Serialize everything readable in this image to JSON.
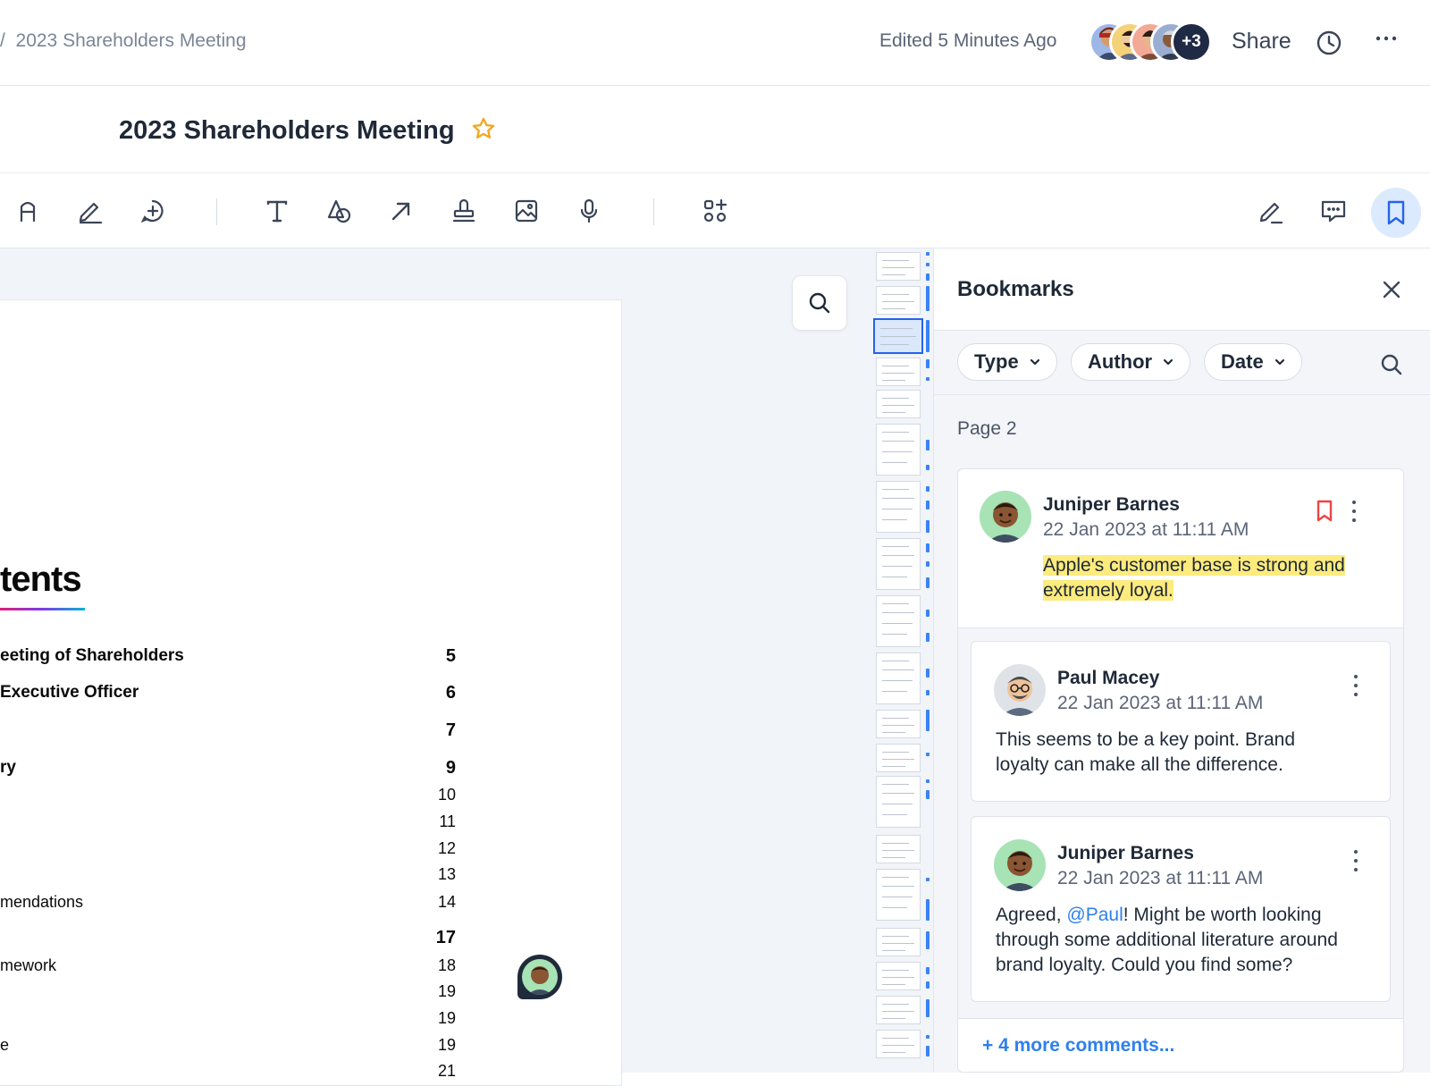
{
  "header": {
    "breadcrumb_sep": "/",
    "breadcrumb": "2023 Shareholders Meeting",
    "edited": "Edited 5 Minutes Ago",
    "avatars_more": "+3",
    "share_label": "Share"
  },
  "document": {
    "title": "2023 Shareholders Meeting",
    "heading": "tents",
    "toc": [
      {
        "label": "eeting of Shareholders",
        "page": "5"
      },
      {
        "label": "Executive Officer",
        "page": "6"
      },
      {
        "label": "",
        "page": "7"
      },
      {
        "label": "ry",
        "page": "9"
      },
      {
        "label": "",
        "page": "10"
      },
      {
        "label": "",
        "page": "11"
      },
      {
        "label": "",
        "page": "12"
      },
      {
        "label": "",
        "page": "13"
      },
      {
        "label": "mendations",
        "page": "14"
      },
      {
        "label": "",
        "page": "17"
      },
      {
        "label": "mework",
        "page": "18"
      },
      {
        "label": "",
        "page": "19"
      },
      {
        "label": "",
        "page": "19"
      },
      {
        "label": "e",
        "page": "19"
      },
      {
        "label": "",
        "page": "21"
      }
    ]
  },
  "panel": {
    "title": "Bookmarks",
    "filters": [
      "Type",
      "Author",
      "Date"
    ],
    "page_label": "Page 2",
    "comments": [
      {
        "name": "Juniper Barnes",
        "date": "22 Jan 2023 at 11:11 AM",
        "text": "Apple's customer base is strong and extremely loyal."
      },
      {
        "name": "Paul Macey",
        "date": "22 Jan 2023 at 11:11 AM",
        "text_line1": "This seems to be a key point. Brand",
        "text_line2": "loyalty can make all the difference."
      },
      {
        "name": "Juniper Barnes",
        "date": "22 Jan 2023 at 11:11 AM",
        "text_prefix": "Agreed, ",
        "mention": "@Paul",
        "text_line1_rest": "! Might be worth looking",
        "text_line2": "through some additional literature around",
        "text_line3": "brand loyalty. Could you find some?"
      }
    ],
    "more_comments": "+ 4 more comments..."
  },
  "colors": {
    "accent": "#3b82f6",
    "bookmark_active": "#ef4444",
    "star": "#f5a623",
    "highlight": "#fdeb7d"
  },
  "icons": [
    "clock-icon",
    "more-icon",
    "star-icon",
    "text-style-icon",
    "pen-icon",
    "add-comment-icon",
    "text-icon",
    "shape-icon",
    "arrow-icon",
    "stamp-icon",
    "image-icon",
    "microphone-icon",
    "apps-icon",
    "edit-icon",
    "comments-icon",
    "bookmark-icon",
    "search-icon",
    "close-icon",
    "chevron-down-icon",
    "kebab-icon"
  ]
}
